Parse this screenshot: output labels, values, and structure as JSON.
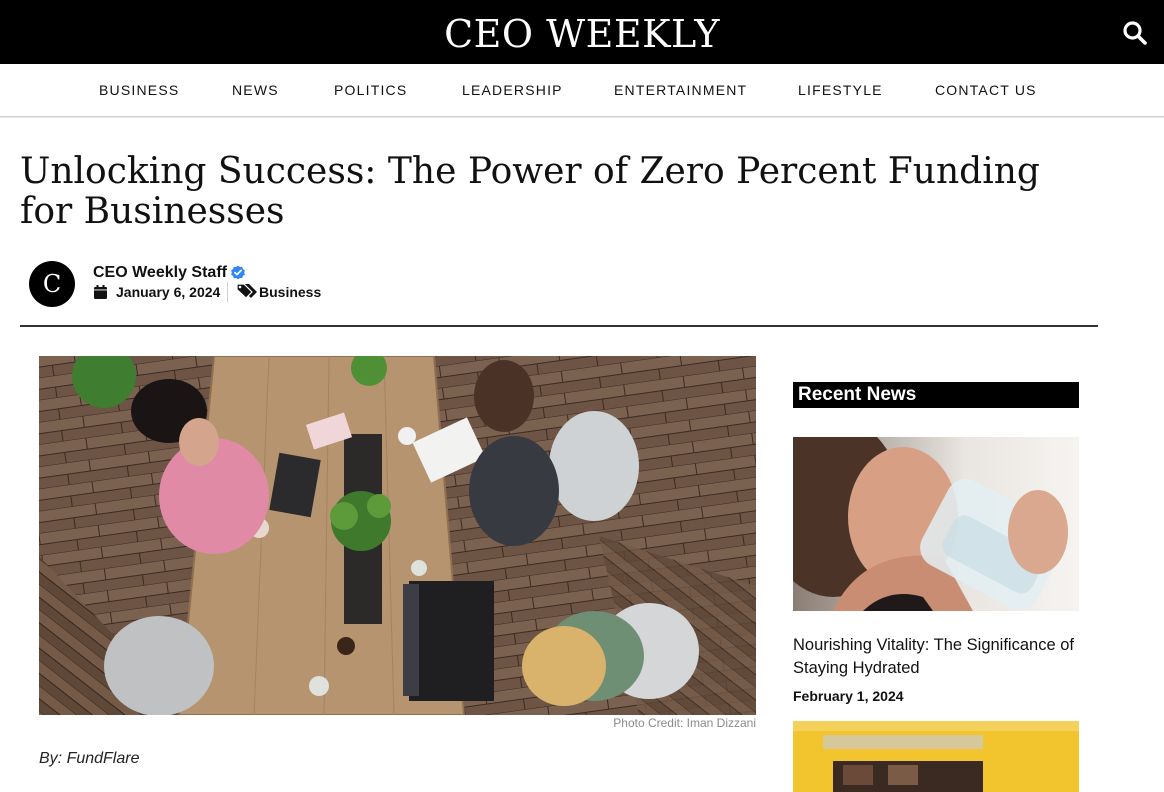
{
  "site": {
    "name": "CEO WEEKLY"
  },
  "nav": {
    "items": [
      {
        "label": "BUSINESS"
      },
      {
        "label": "NEWS"
      },
      {
        "label": "POLITICS"
      },
      {
        "label": "LEADERSHIP"
      },
      {
        "label": "ENTERTAINMENT"
      },
      {
        "label": "LIFESTYLE"
      },
      {
        "label": "CONTACT US"
      }
    ]
  },
  "article": {
    "title": "Unlocking Success: The Power of Zero Percent Funding for Businesses",
    "avatar_letter": "C",
    "author": "CEO Weekly Staff",
    "date": "January 6, 2024",
    "category": "Business",
    "photo_credit": "Photo Credit: Iman Dizzani",
    "byline": "By: FundFlare"
  },
  "sidebar": {
    "heading": "Recent News",
    "posts": [
      {
        "title": "Nourishing Vitality: The Significance of Staying Hydrated",
        "date": "February 1, 2024"
      }
    ]
  },
  "colors": {
    "header_bg": "#000000",
    "verified_badge": "#2f86f6",
    "text": "#111111"
  },
  "icons": [
    "search-icon",
    "verified-icon",
    "calendar-icon",
    "tags-icon"
  ]
}
